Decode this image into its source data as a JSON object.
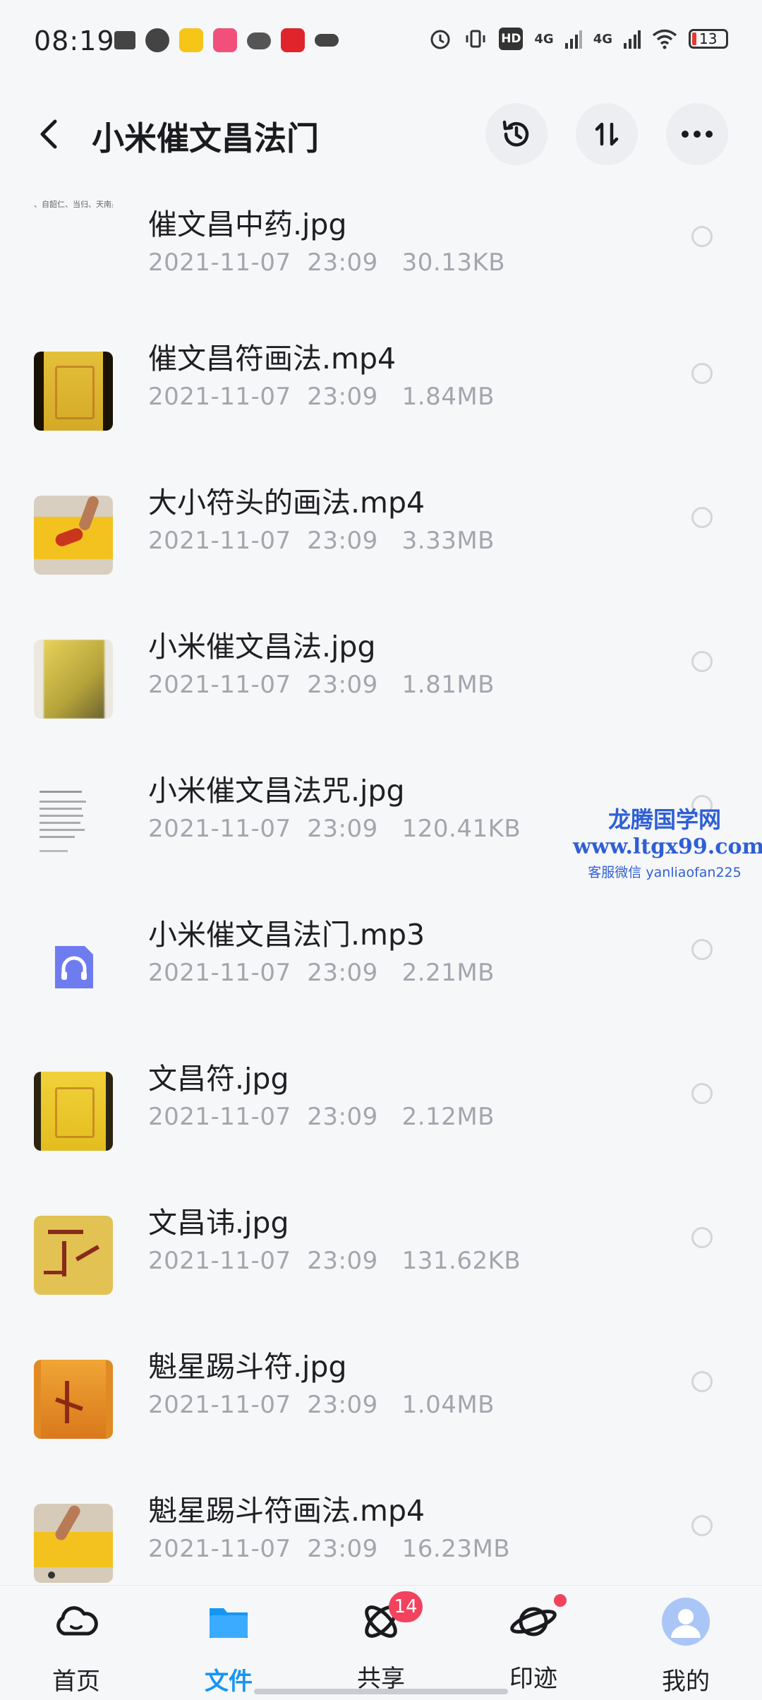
{
  "status": {
    "time": "08:19",
    "network_1": "4G",
    "network_2": "4G",
    "battery": "13"
  },
  "header": {
    "title": "小米催文昌法门"
  },
  "files": [
    {
      "name": "催文昌中药.jpg",
      "date": "2021-11-07",
      "time": "23:09",
      "size": "30.13KB",
      "thumb": "text-page",
      "thumb_text": "、自韶仁、当归、天南星"
    },
    {
      "name": "催文昌符画法.mp4",
      "date": "2021-11-07",
      "time": "23:09",
      "size": "1.84MB",
      "thumb": "yellow-talisman-dark"
    },
    {
      "name": "大小符头的画法.mp4",
      "date": "2021-11-07",
      "time": "23:09",
      "size": "3.33MB",
      "thumb": "hand-drawing"
    },
    {
      "name": "小米催文昌法.jpg",
      "date": "2021-11-07",
      "time": "23:09",
      "size": "1.81MB",
      "thumb": "yellow-blur"
    },
    {
      "name": "小米催文昌法咒.jpg",
      "date": "2021-11-07",
      "time": "23:09",
      "size": "120.41KB",
      "thumb": "text-lines"
    },
    {
      "name": "小米催文昌法门.mp3",
      "date": "2021-11-07",
      "time": "23:09",
      "size": "2.21MB",
      "thumb": "audio-icon"
    },
    {
      "name": "文昌符.jpg",
      "date": "2021-11-07",
      "time": "23:09",
      "size": "2.12MB",
      "thumb": "yellow-talisman"
    },
    {
      "name": "文昌讳.jpg",
      "date": "2021-11-07",
      "time": "23:09",
      "size": "131.62KB",
      "thumb": "yellow-calligraphy"
    },
    {
      "name": "魁星踢斗符.jpg",
      "date": "2021-11-07",
      "time": "23:09",
      "size": "1.04MB",
      "thumb": "orange-talisman"
    },
    {
      "name": "魁星踢斗符画法.mp4",
      "date": "2021-11-07",
      "time": "23:09",
      "size": "16.23MB",
      "thumb": "hand-drawing-2"
    }
  ],
  "watermark": {
    "line1": "龙腾国学网",
    "line2": "www.ltgx99.com",
    "line3": "客服微信 yanliaofan225"
  },
  "nav": [
    {
      "label": "首页",
      "icon": "cloud-icon"
    },
    {
      "label": "文件",
      "icon": "folder-icon",
      "active": true
    },
    {
      "label": "共享",
      "icon": "atom-icon",
      "badge": "14"
    },
    {
      "label": "印迹",
      "icon": "planet-icon",
      "dot": true
    },
    {
      "label": "我的",
      "icon": "avatar-icon"
    }
  ],
  "colors": {
    "accent": "#1596f5",
    "badge": "#f2425e",
    "meta": "#a3a6ad",
    "watermark": "#2f5fd6"
  }
}
